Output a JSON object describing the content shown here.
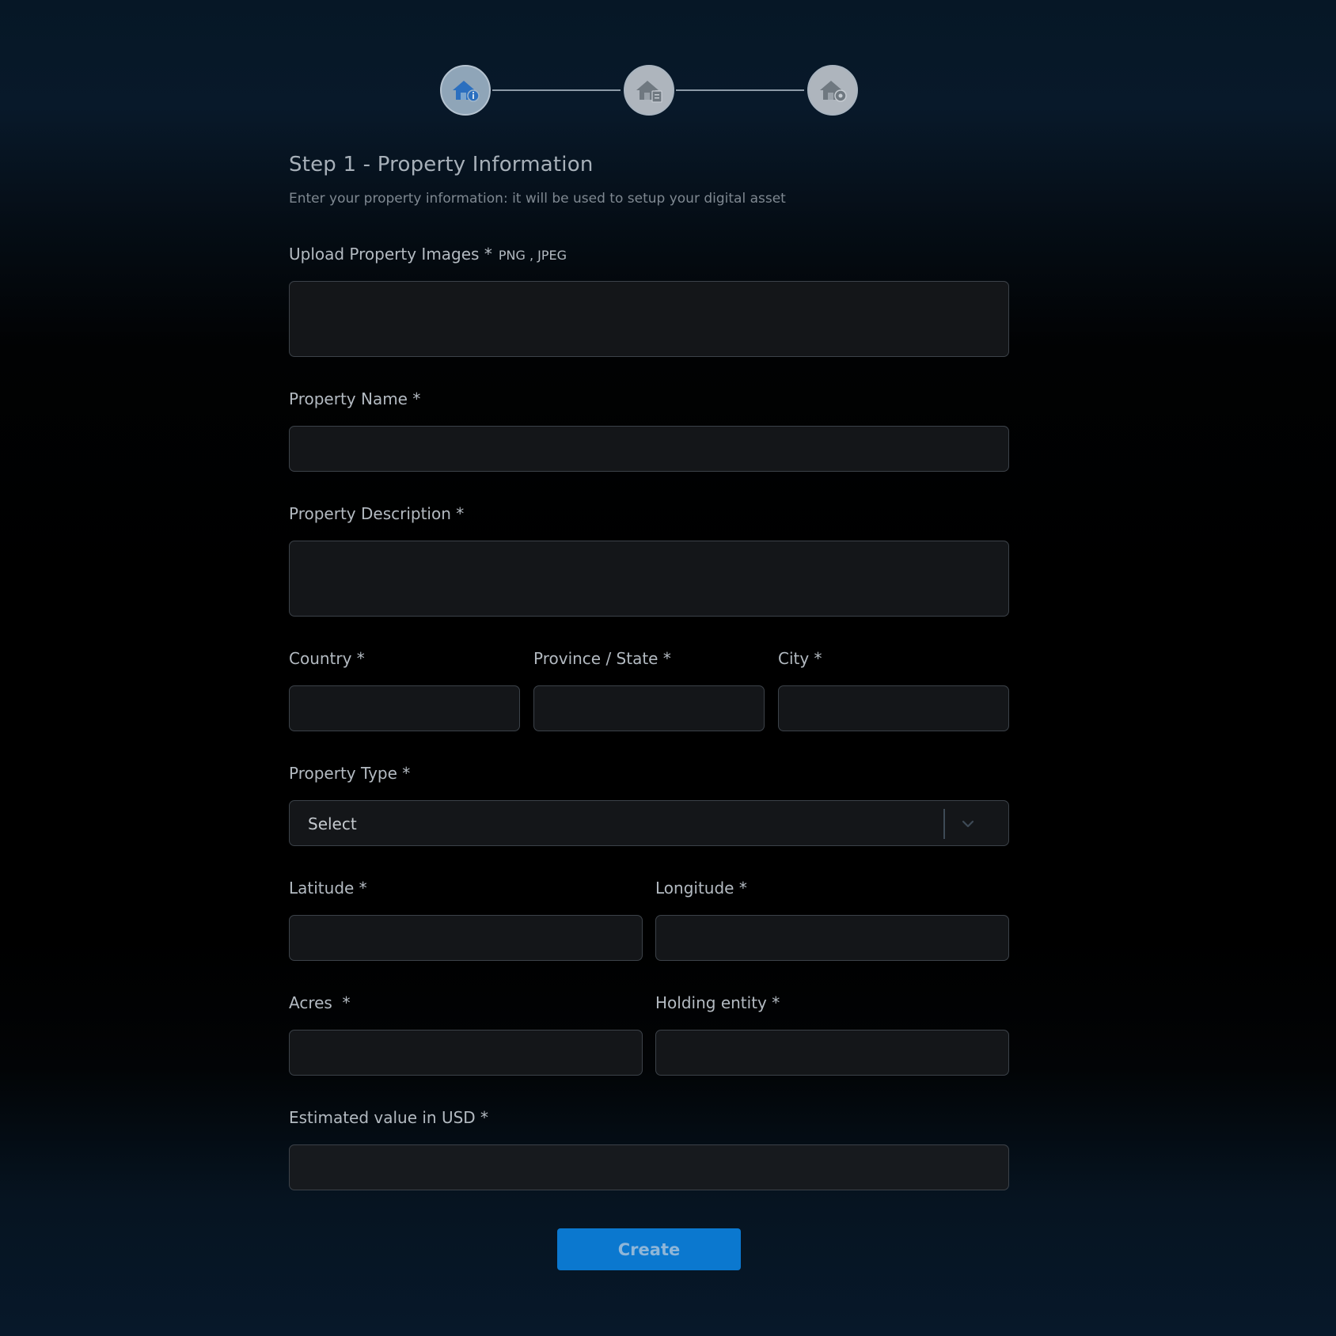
{
  "stepper": {
    "steps": [
      {
        "icon": "house-info-icon",
        "state": "active"
      },
      {
        "icon": "house-document-icon",
        "state": "inactive"
      },
      {
        "icon": "house-settings-icon",
        "state": "inactive"
      }
    ]
  },
  "header": {
    "title": "Step 1 - Property Information",
    "subtitle": "Enter your property information: it will be used to setup your digital asset"
  },
  "form": {
    "upload_label": "Upload Property Images *",
    "upload_hint": "PNG , JPEG",
    "name_label": "Property Name *",
    "description_label": "Property Description *",
    "country_label": "Country *",
    "province_label": "Province / State *",
    "city_label": "City *",
    "type_label": "Property Type *",
    "type_value": "Select",
    "latitude_label": "Latitude *",
    "longitude_label": "Longitude *",
    "acres_label": "Acres  *",
    "holding_label": "Holding entity *",
    "estimated_label": "Estimated value in USD *",
    "create_label": "Create"
  },
  "colors": {
    "accent": "#0b78cf",
    "background_top": "#061726",
    "field_bg": "#141619",
    "field_border": "#3c4249"
  }
}
